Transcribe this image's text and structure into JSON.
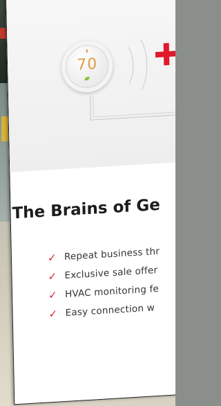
{
  "thermostat": {
    "temperature": "70"
  },
  "heading": "The Brains of Ge",
  "features": [
    "Repeat business thr",
    "Exclusive sale offer",
    "HVAC monitoring fe",
    "Easy connection w"
  ],
  "colors": {
    "accent_red": "#e0192b",
    "check_red": "#d81f2f",
    "temp_orange": "#e29b45",
    "leaf_green": "#86c23d"
  },
  "icons": {
    "plus": "plus-icon",
    "check": "check-icon",
    "leaf": "leaf-icon"
  }
}
